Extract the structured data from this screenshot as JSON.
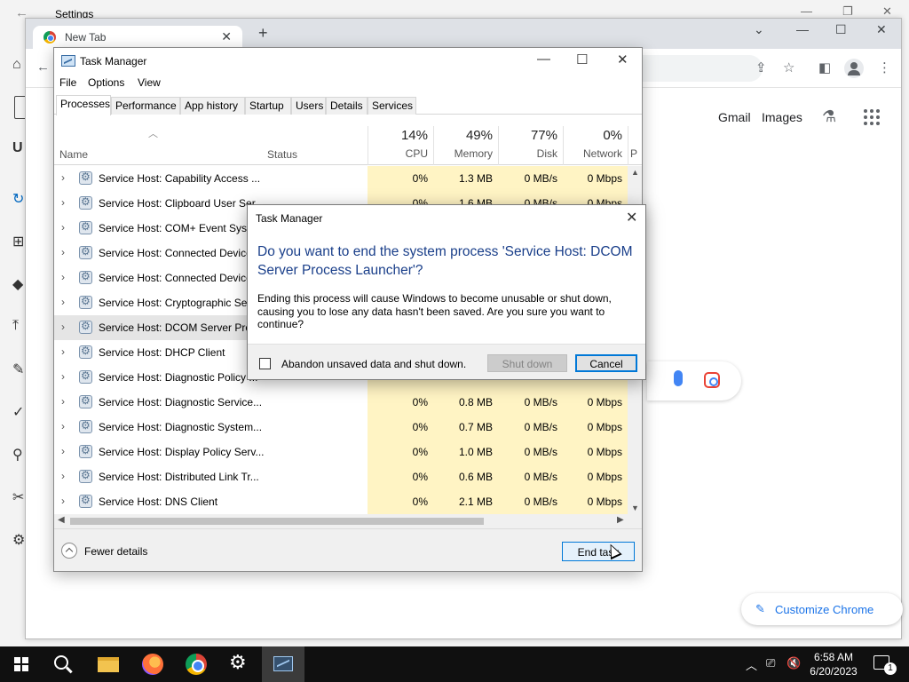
{
  "settings": {
    "title": "Settings",
    "side_letter": "U"
  },
  "chrome": {
    "tab_label": "New Tab",
    "links": {
      "gmail": "Gmail",
      "images": "Images"
    },
    "customize_label": "Customize Chrome"
  },
  "task_manager": {
    "title": "Task Manager",
    "menu": [
      "File",
      "Options",
      "View"
    ],
    "tabs": [
      "Processes",
      "Performance",
      "App history",
      "Startup",
      "Users",
      "Details",
      "Services"
    ],
    "columns": {
      "name": "Name",
      "status": "Status",
      "cpu": {
        "pct": "14%",
        "label": "CPU"
      },
      "memory": {
        "pct": "49%",
        "label": "Memory"
      },
      "disk": {
        "pct": "77%",
        "label": "Disk"
      },
      "network": {
        "pct": "0%",
        "label": "Network"
      },
      "power_trunc": "P"
    },
    "rows": [
      {
        "name": "Service Host: Capability Access ...",
        "cpu": "0%",
        "memory": "1.3 MB",
        "disk": "0 MB/s",
        "network": "0 Mbps"
      },
      {
        "name": "Service Host: Clipboard User Ser...",
        "cpu": "0%",
        "memory": "1.6 MB",
        "disk": "0 MB/s",
        "network": "0 Mbps"
      },
      {
        "name": "Service Host: COM+ Event Syste...",
        "cpu": "0%",
        "memory": "",
        "disk": "",
        "network": ""
      },
      {
        "name": "Service Host: Connected Device...",
        "cpu": "",
        "memory": "",
        "disk": "",
        "network": ""
      },
      {
        "name": "Service Host: Connected Device...",
        "cpu": "",
        "memory": "",
        "disk": "",
        "network": ""
      },
      {
        "name": "Service Host: Cryptographic Ser...",
        "cpu": "",
        "memory": "",
        "disk": "",
        "network": ""
      },
      {
        "name": "Service Host: DCOM Server Proc...",
        "cpu": "",
        "memory": "",
        "disk": "",
        "network": ""
      },
      {
        "name": "Service Host: DHCP Client",
        "cpu": "",
        "memory": "",
        "disk": "",
        "network": ""
      },
      {
        "name": "Service Host: Diagnostic Policy ...",
        "cpu": "",
        "memory": "",
        "disk": "",
        "network": ""
      },
      {
        "name": "Service Host: Diagnostic Service...",
        "cpu": "0%",
        "memory": "0.8 MB",
        "disk": "0 MB/s",
        "network": "0 Mbps"
      },
      {
        "name": "Service Host: Diagnostic System...",
        "cpu": "0%",
        "memory": "0.7 MB",
        "disk": "0 MB/s",
        "network": "0 Mbps"
      },
      {
        "name": "Service Host: Display Policy Serv...",
        "cpu": "0%",
        "memory": "1.0 MB",
        "disk": "0 MB/s",
        "network": "0 Mbps"
      },
      {
        "name": "Service Host: Distributed Link Tr...",
        "cpu": "0%",
        "memory": "0.6 MB",
        "disk": "0 MB/s",
        "network": "0 Mbps"
      },
      {
        "name": "Service Host: DNS Client",
        "cpu": "0%",
        "memory": "2.1 MB",
        "disk": "0 MB/s",
        "network": "0 Mbps"
      }
    ],
    "selected_row": 6,
    "fewer_details": "Fewer details",
    "end_task": "End task"
  },
  "dialog": {
    "title": "Task Manager",
    "heading": "Do you want to end the system process 'Service Host: DCOM Server Process Launcher'?",
    "body": "Ending this process will cause Windows to become unusable or shut down, causing you to lose any data hasn't been saved. Are you sure you want to continue?",
    "checkbox_label": "Abandon unsaved data and shut down.",
    "shutdown_label": "Shut down",
    "cancel_label": "Cancel"
  },
  "taskbar": {
    "time": "6:58 AM",
    "date": "6/20/2023",
    "notification_count": "1"
  }
}
